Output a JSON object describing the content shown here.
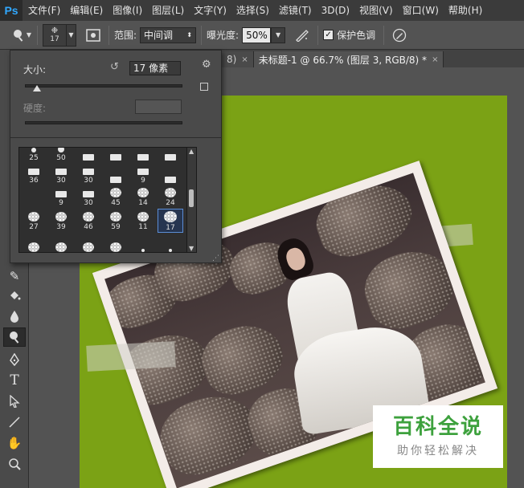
{
  "app": {
    "logo": "Ps"
  },
  "menu": [
    "文件(F)",
    "编辑(E)",
    "图像(I)",
    "图层(L)",
    "文字(Y)",
    "选择(S)",
    "滤镜(T)",
    "3D(D)",
    "视图(V)",
    "窗口(W)",
    "帮助(H)"
  ],
  "options": {
    "brush_size": "17",
    "range_label": "范围:",
    "range_value": "中间调",
    "exposure_label": "曝光度:",
    "exposure_value": "50%",
    "protect_label": "保护色调",
    "protect_checked": "✓"
  },
  "tabs": [
    {
      "label": "8)",
      "close": "×"
    },
    {
      "label": "未标题-1 @ 66.7% (图层 3, RGB/8) *",
      "close": "×"
    }
  ],
  "brush_panel": {
    "size_label": "大小:",
    "size_value": "17 像素",
    "hardness_label": "硬度:",
    "brushes": [
      {
        "label": "25"
      },
      {
        "label": "50"
      },
      {
        "label": ""
      },
      {
        "label": ""
      },
      {
        "label": ""
      },
      {
        "label": ""
      },
      {
        "label": "36"
      },
      {
        "label": "30"
      },
      {
        "label": "30"
      },
      {
        "label": ""
      },
      {
        "label": "9"
      },
      {
        "label": ""
      },
      {
        "label": ""
      },
      {
        "label": "9"
      },
      {
        "label": "30"
      },
      {
        "label": "45"
      },
      {
        "label": "14"
      },
      {
        "label": "24"
      },
      {
        "label": "27"
      },
      {
        "label": "39"
      },
      {
        "label": "46"
      },
      {
        "label": "59"
      },
      {
        "label": "11"
      },
      {
        "label": "17"
      },
      {
        "label": ""
      },
      {
        "label": ""
      },
      {
        "label": ""
      },
      {
        "label": ""
      },
      {
        "label": ""
      },
      {
        "label": ""
      }
    ],
    "selected_brush": "17"
  },
  "watermark": {
    "title": "百科全说",
    "subtitle": "助你轻松解决"
  },
  "tools": [
    "burn-tool",
    "paint-bucket-tool",
    "blur-tool",
    "dodge-tool",
    "pen-tool",
    "type-tool",
    "path-selection-tool",
    "line-tool",
    "hand-tool",
    "zoom-tool"
  ]
}
